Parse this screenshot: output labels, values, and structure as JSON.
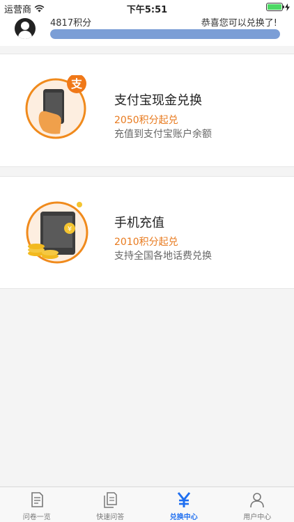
{
  "status": {
    "carrier": "运营商",
    "time": "下午5:51",
    "battery_level": 1.0
  },
  "user": {
    "points_label": "4817积分",
    "message": "恭喜您可以兑换了!",
    "progress_fraction": 1.0
  },
  "offers": [
    {
      "icon": "alipay-phone-icon",
      "title": "支付宝现金兑换",
      "points": "2050积分起兑",
      "description": "充值到支付宝账户余额"
    },
    {
      "icon": "mobile-recharge-icon",
      "title": "手机充值",
      "points": "2010积分起兑",
      "description": "支持全国各地话费兑换"
    }
  ],
  "tabs": [
    {
      "label": "问卷一览",
      "icon": "document-icon",
      "active": false
    },
    {
      "label": "快速问答",
      "icon": "documents-icon",
      "active": false
    },
    {
      "label": "兑换中心",
      "icon": "yen-icon",
      "active": true
    },
    {
      "label": "用户中心",
      "icon": "user-icon",
      "active": false
    }
  ],
  "colors": {
    "accent": "#1f6ff0",
    "orange": "#e87a1e",
    "progress": "#7b9ed6"
  }
}
